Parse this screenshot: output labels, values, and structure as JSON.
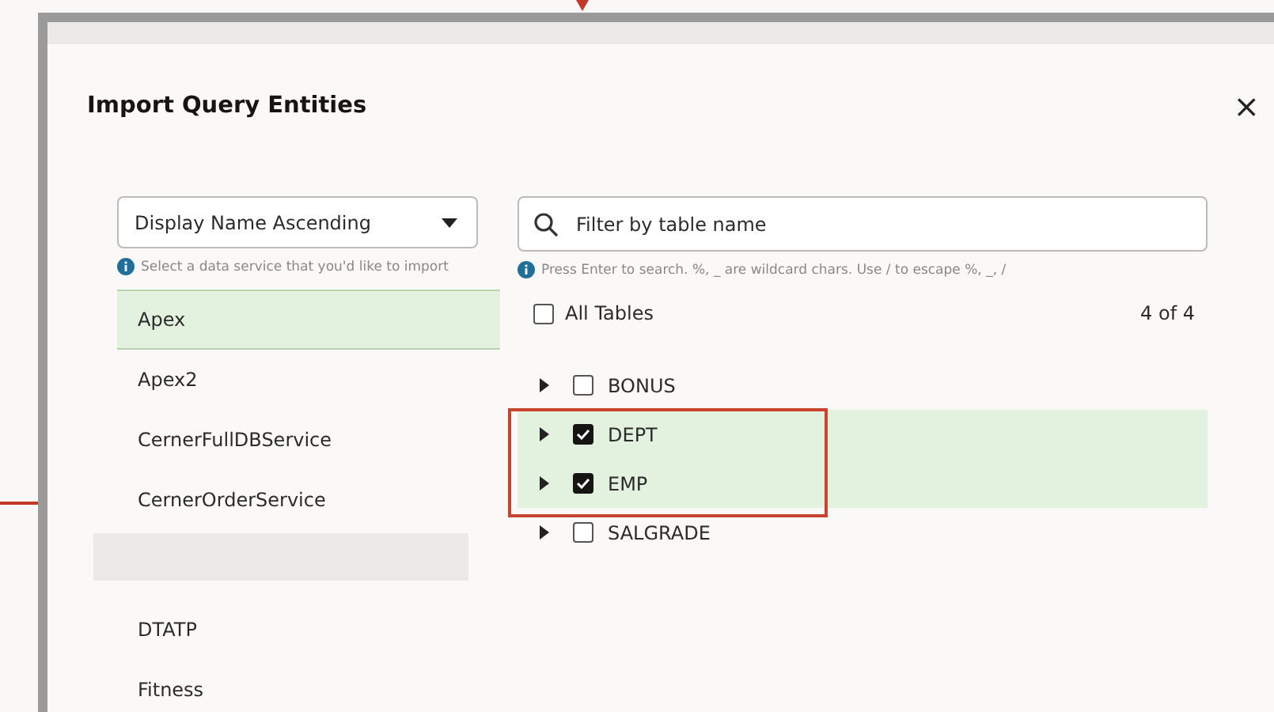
{
  "dialog": {
    "title": "Import Query Entities",
    "close": "×"
  },
  "sort_select": {
    "value": "Display Name Ascending",
    "hint": "Select a data service that you'd like to import"
  },
  "services": [
    {
      "name": "Apex",
      "selected": true,
      "hovered": false
    },
    {
      "name": "Apex2",
      "selected": false,
      "hovered": false
    },
    {
      "name": "CernerFullDBService",
      "selected": false,
      "hovered": false
    },
    {
      "name": "CernerOrderService",
      "selected": false,
      "hovered": false
    },
    {
      "selected": false,
      "hovered": true
    },
    {
      "name": "DTATP",
      "selected": false,
      "hovered": false
    },
    {
      "name": "Fitness",
      "selected": false,
      "hovered": false
    }
  ],
  "search": {
    "placeholder": "Filter by table name",
    "hint": "Press Enter to search. %, _ are wildcard chars. Use / to escape %, _, /"
  },
  "all_tables": {
    "label": "All Tables",
    "checked": false,
    "count": "4 of 4"
  },
  "tables": [
    {
      "name": "BONUS",
      "checked": false,
      "expanded": false
    },
    {
      "name": "DEPT",
      "checked": true,
      "expanded": false
    },
    {
      "name": "EMP",
      "checked": true,
      "expanded": false
    },
    {
      "name": "SALGRADE",
      "checked": false,
      "expanded": false
    }
  ]
}
